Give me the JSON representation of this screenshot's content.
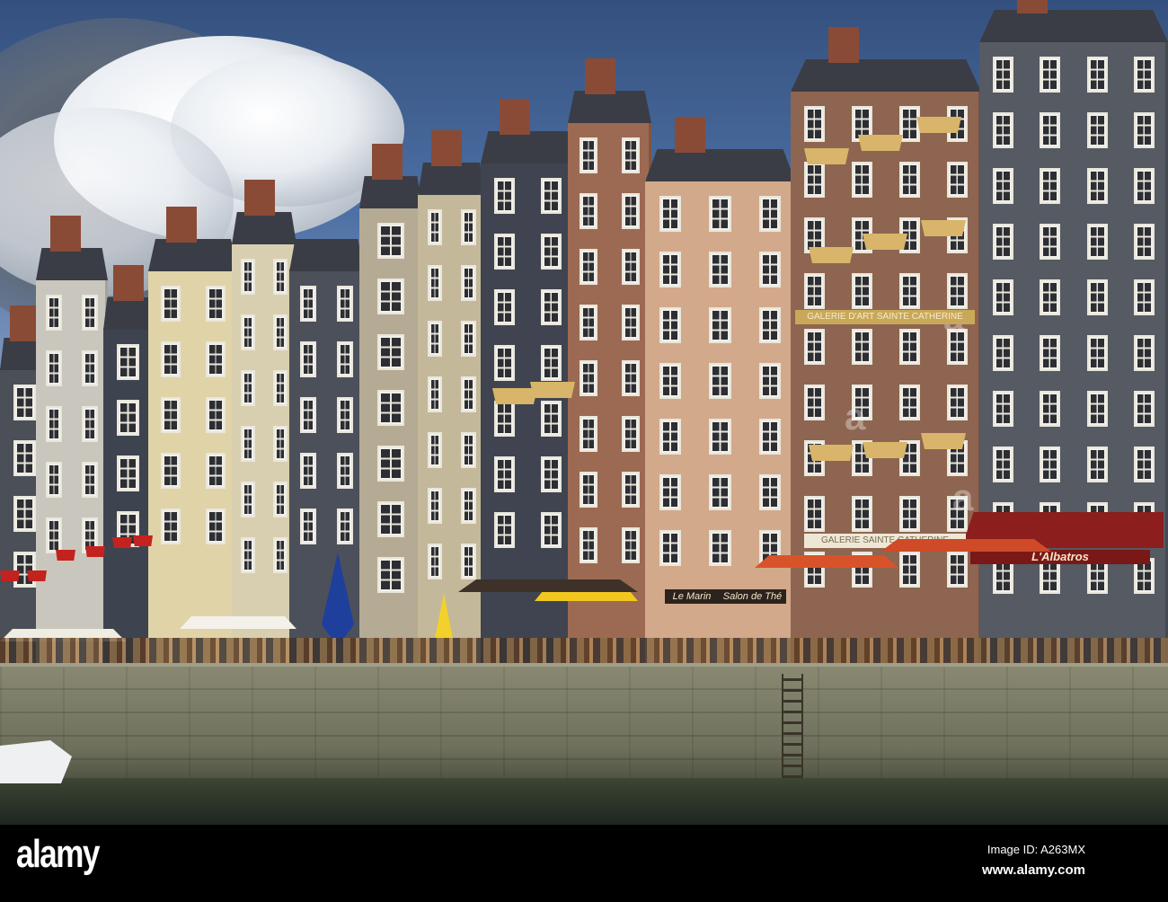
{
  "photo": {
    "subject": "Honfleur harbour quayside",
    "signs": {
      "gallery_awning": "GALERIE D'ART SAINTE CATHERINE",
      "gallery_ground": "GALERIE SAINTE CATHERINE",
      "albatros": "L'Albatros",
      "le_marin": "Le Marin",
      "salon": "Salon de Thé"
    },
    "colors": {
      "sky": "#4c6fa3",
      "slate": "#4b505b",
      "brick": "#8e6550",
      "red_awning": "#8c1e1e",
      "umbrella": "#d9532a"
    }
  },
  "watermark": {
    "logo": "alamy",
    "image_id": "Image ID: A263MX",
    "url": "www.alamy.com",
    "overlay_mark": "a"
  }
}
